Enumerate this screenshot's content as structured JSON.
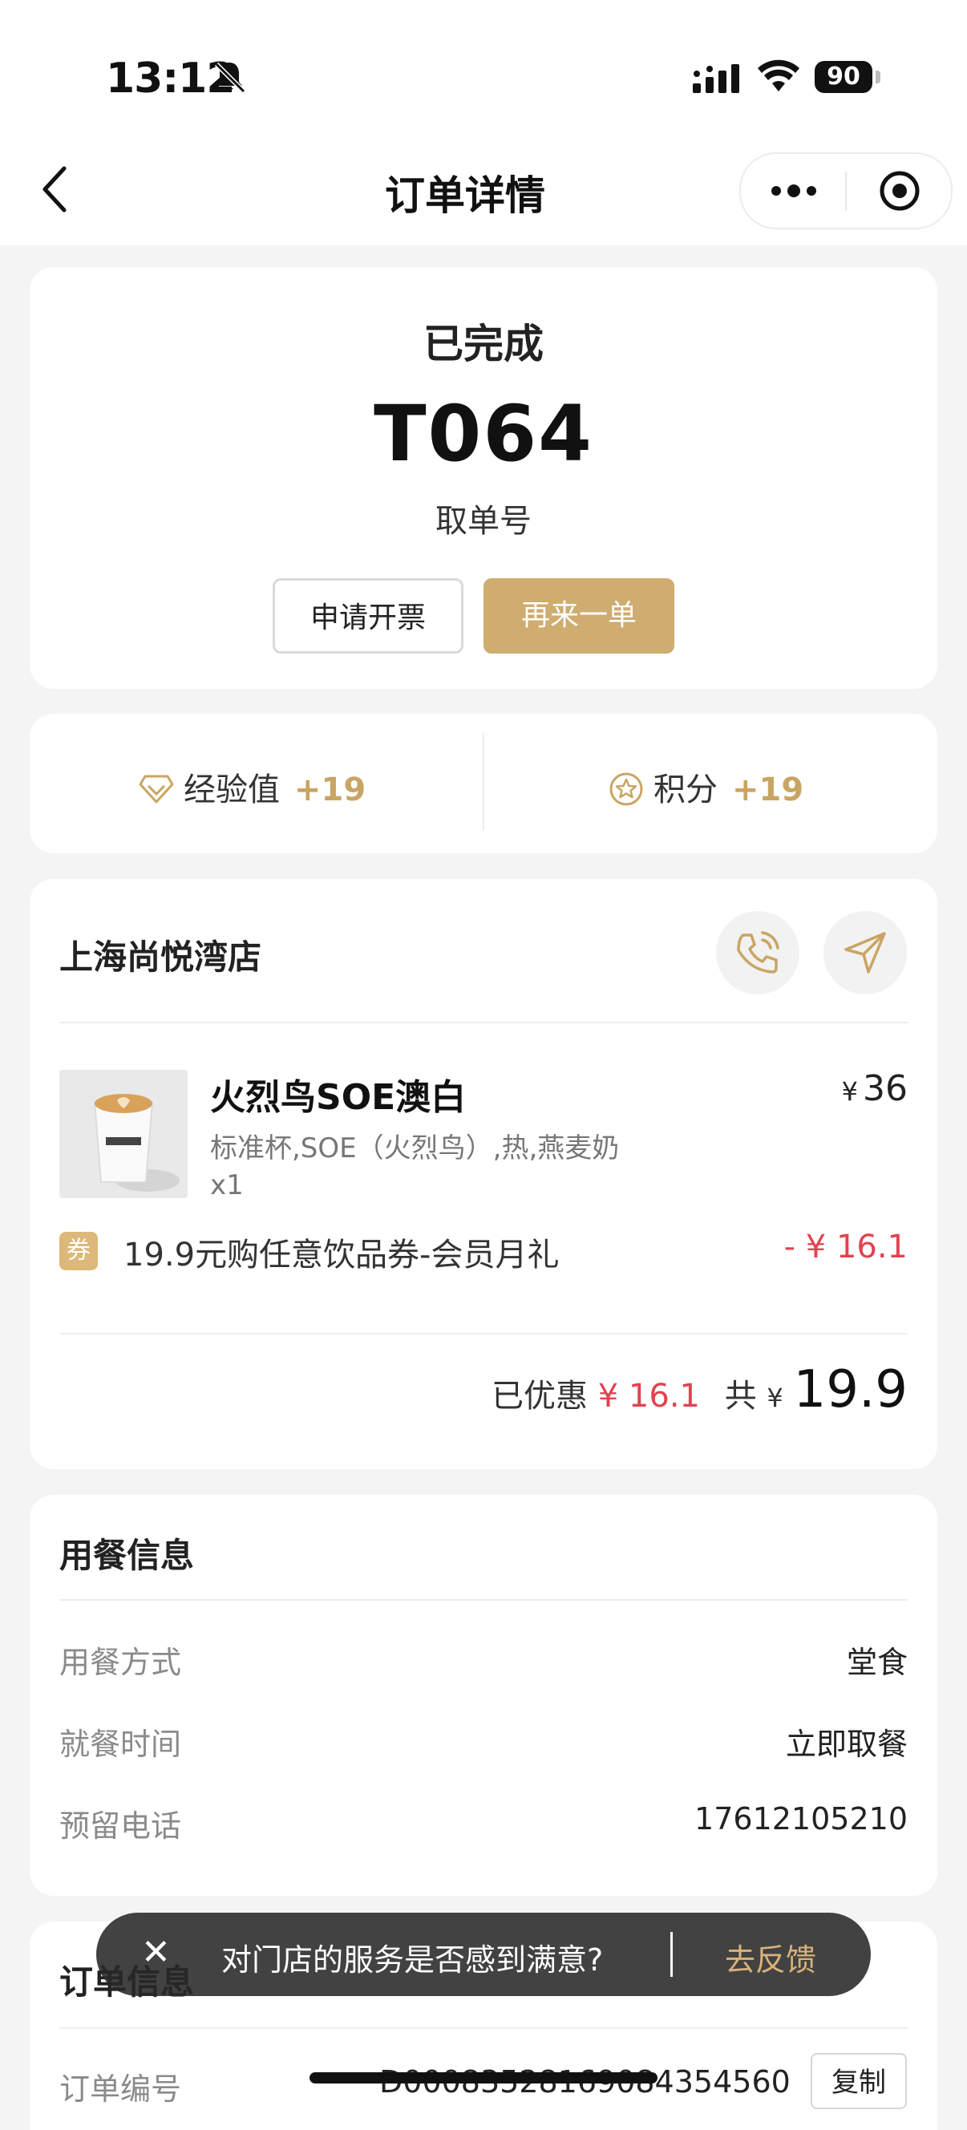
{
  "status_bar": {
    "time": "13:12",
    "battery": "90"
  },
  "nav": {
    "title": "订单详情"
  },
  "order_status": {
    "status": "已完成",
    "pickup_number": "T064",
    "pickup_label": "取单号",
    "invoice_button": "申请开票",
    "reorder_button": "再来一单"
  },
  "rewards": {
    "experience_label": "经验值",
    "experience_value": "+19",
    "points_label": "积分",
    "points_value": "+19"
  },
  "store": {
    "name": "上海尚悦湾店",
    "product": {
      "name": "火烈鸟SOE澳白",
      "spec": "标准杯,SOE（火烈鸟）,热,燕麦奶",
      "qty": "x1",
      "price_symbol": "¥",
      "price": "36"
    },
    "coupon": {
      "tag": "券",
      "name": "19.9元购任意饮品券-会员月礼",
      "amount": "- ¥ 16.1"
    },
    "summary": {
      "discount_label": "已优惠",
      "discount_value": "¥ 16.1",
      "total_label": "共",
      "total_symbol": "¥",
      "total_value": "19.9"
    }
  },
  "dining_info": {
    "title": "用餐信息",
    "rows": [
      {
        "label": "用餐方式",
        "value": "堂食"
      },
      {
        "label": "就餐时间",
        "value": "立即取餐"
      },
      {
        "label": "预留电话",
        "value": "17612105210"
      }
    ]
  },
  "order_info": {
    "title": "订单信息",
    "order_no_label": "订单编号",
    "order_no": "D00083528169084354560",
    "copy_button": "复制"
  },
  "toast": {
    "message": "对门店的服务是否感到满意?",
    "action": "去反馈"
  },
  "colors": {
    "gold": "#cfac70",
    "red": "#e2424f"
  }
}
